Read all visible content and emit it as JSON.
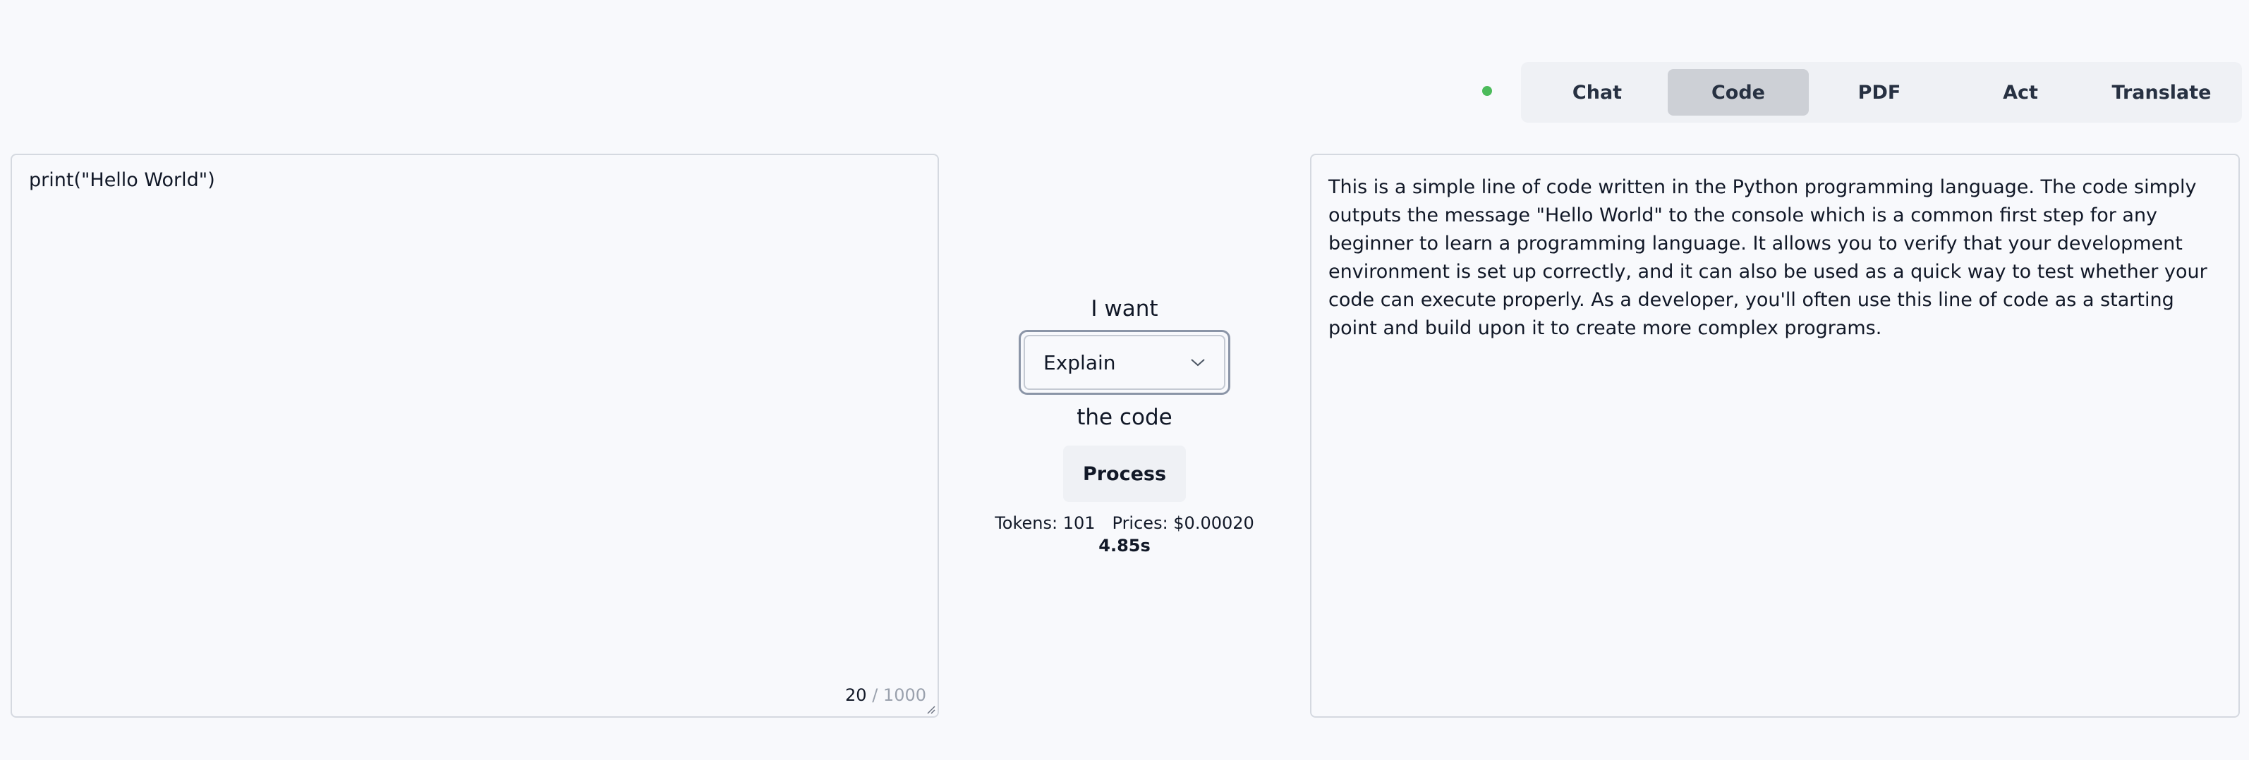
{
  "status": {
    "color": "#4cbb5b"
  },
  "tabs": [
    {
      "label": "Chat",
      "active": false
    },
    {
      "label": "Code",
      "active": true
    },
    {
      "label": "PDF",
      "active": false
    },
    {
      "label": "Act",
      "active": false
    },
    {
      "label": "Translate",
      "active": false
    }
  ],
  "editor": {
    "value": "print(\"Hello World\")",
    "char_count": "20",
    "char_sep": "/",
    "char_max": "1000"
  },
  "controls": {
    "prefix": "I want",
    "action_selected": "Explain",
    "suffix": "the code",
    "process_label": "Process",
    "tokens_text": "Tokens: 101",
    "prices_text": "Prices: $0.00020",
    "elapsed": "4.85s"
  },
  "output": {
    "text": "This is a simple line of code written in the Python programming language. The code simply outputs the message \"Hello World\" to the console which is a common first step for any beginner to learn a programming language. It allows you to verify that your development environment is set up correctly, and it can also be used as a quick way to test whether your code can execute properly. As a developer, you'll often use this line of code as a starting point and build upon it to create more complex programs."
  }
}
